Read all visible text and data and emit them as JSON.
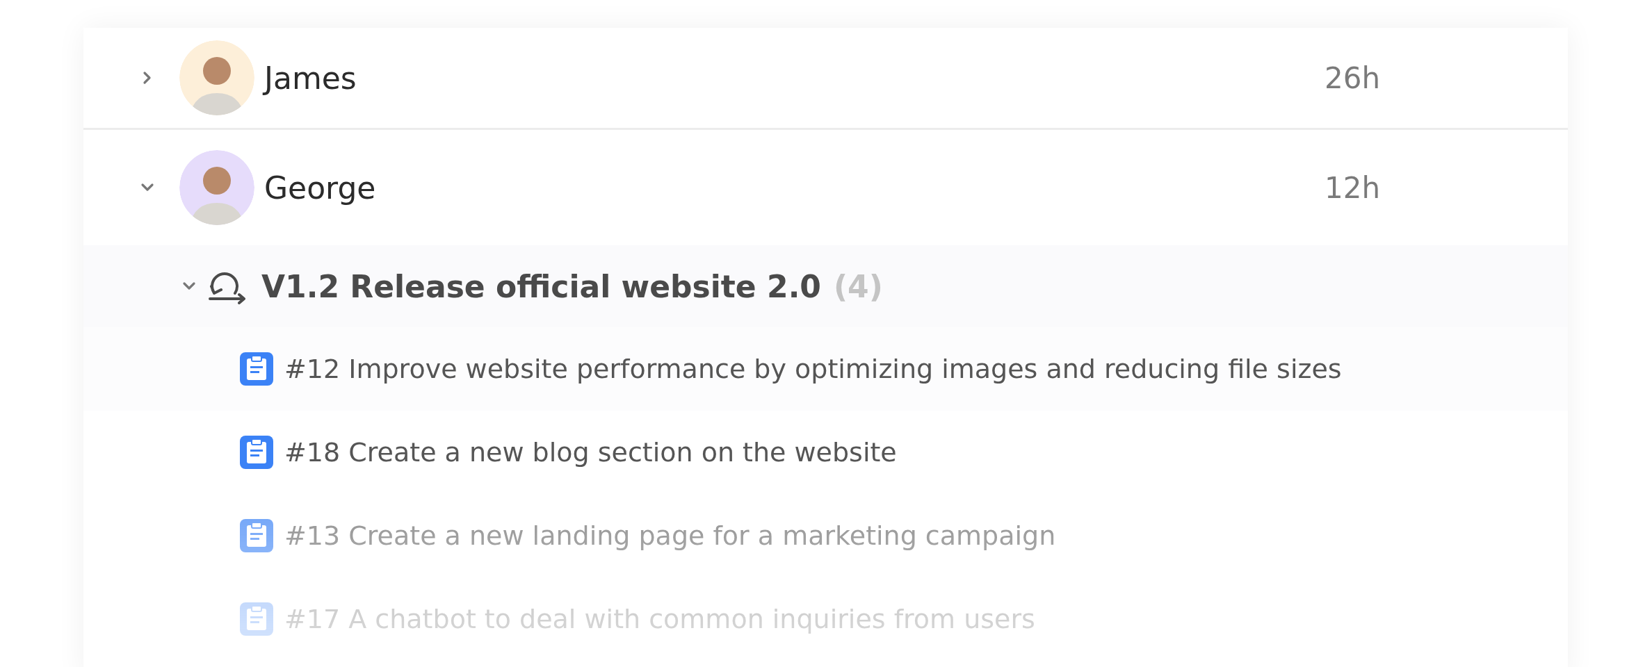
{
  "members": [
    {
      "name": "James",
      "hours": "26h",
      "expanded": false,
      "color": "#fdefd9"
    },
    {
      "name": "George",
      "hours": "12h",
      "expanded": true,
      "color": "#e6dcfb",
      "sprints": [
        {
          "title": "V1.2 Release official website 2.0",
          "count": "(4)",
          "expanded": true,
          "tasks": [
            {
              "text": "#12 Improve website performance by optimizing images and reducing file sizes"
            },
            {
              "text": "#18 Create a new blog section on the website"
            },
            {
              "text": "#13 Create a new landing page for a marketing campaign"
            },
            {
              "text": "#17 A chatbot to deal with common inquiries from users"
            }
          ]
        }
      ]
    }
  ]
}
